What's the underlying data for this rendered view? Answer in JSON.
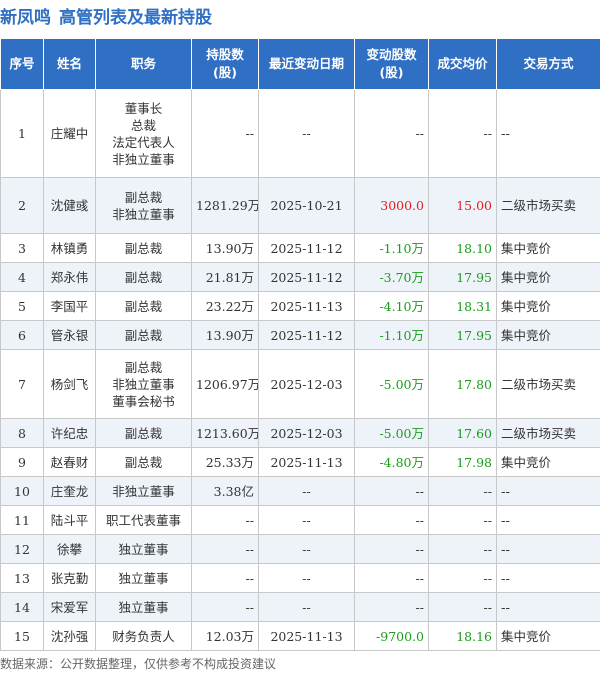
{
  "title": {
    "company": "新凤鸣",
    "subtitle": "高管列表及最新持股"
  },
  "columns": [
    "序号",
    "姓名",
    "职务",
    "持股数\n(股)",
    "最近变动日期",
    "变动股数\n(股)",
    "成交均价",
    "交易方式"
  ],
  "rows": [
    {
      "no": "1",
      "name": "庄耀中",
      "roles": [
        "董事长",
        "总裁",
        "法定代表人",
        "非独立董事"
      ],
      "shares": "--",
      "date": "--",
      "change": "--",
      "price": "--",
      "method": "--",
      "change_color": "none",
      "price_color": "none"
    },
    {
      "no": "2",
      "name": "沈健彧",
      "roles": [
        "副总裁",
        "非独立董事"
      ],
      "shares": "1281.29万",
      "date": "2025-10-21",
      "change": "3000.0",
      "price": "15.00",
      "method": "二级市场买卖",
      "change_color": "red",
      "price_color": "red"
    },
    {
      "no": "3",
      "name": "林镇勇",
      "roles": [
        "副总裁"
      ],
      "shares": "13.90万",
      "date": "2025-11-12",
      "change": "-1.10万",
      "price": "18.10",
      "method": "集中竞价",
      "change_color": "green",
      "price_color": "green"
    },
    {
      "no": "4",
      "name": "郑永伟",
      "roles": [
        "副总裁"
      ],
      "shares": "21.81万",
      "date": "2025-11-12",
      "change": "-3.70万",
      "price": "17.95",
      "method": "集中竞价",
      "change_color": "green",
      "price_color": "green"
    },
    {
      "no": "5",
      "name": "李国平",
      "roles": [
        "副总裁"
      ],
      "shares": "23.22万",
      "date": "2025-11-13",
      "change": "-4.10万",
      "price": "18.31",
      "method": "集中竞价",
      "change_color": "green",
      "price_color": "green"
    },
    {
      "no": "6",
      "name": "管永银",
      "roles": [
        "副总裁"
      ],
      "shares": "13.90万",
      "date": "2025-11-12",
      "change": "-1.10万",
      "price": "17.95",
      "method": "集中竞价",
      "change_color": "green",
      "price_color": "green"
    },
    {
      "no": "7",
      "name": "杨剑飞",
      "roles": [
        "副总裁",
        "非独立董事",
        "董事会秘书"
      ],
      "shares": "1206.97万",
      "date": "2025-12-03",
      "change": "-5.00万",
      "price": "17.80",
      "method": "二级市场买卖",
      "change_color": "green",
      "price_color": "green"
    },
    {
      "no": "8",
      "name": "许纪忠",
      "roles": [
        "副总裁"
      ],
      "shares": "1213.60万",
      "date": "2025-12-03",
      "change": "-5.00万",
      "price": "17.60",
      "method": "二级市场买卖",
      "change_color": "green",
      "price_color": "green"
    },
    {
      "no": "9",
      "name": "赵春财",
      "roles": [
        "副总裁"
      ],
      "shares": "25.33万",
      "date": "2025-11-13",
      "change": "-4.80万",
      "price": "17.98",
      "method": "集中竞价",
      "change_color": "green",
      "price_color": "green"
    },
    {
      "no": "10",
      "name": "庄奎龙",
      "roles": [
        "非独立董事"
      ],
      "shares": "3.38亿",
      "date": "--",
      "change": "--",
      "price": "--",
      "method": "--",
      "change_color": "none",
      "price_color": "none"
    },
    {
      "no": "11",
      "name": "陆斗平",
      "roles": [
        "职工代表董事"
      ],
      "shares": "--",
      "date": "--",
      "change": "--",
      "price": "--",
      "method": "--",
      "change_color": "none",
      "price_color": "none"
    },
    {
      "no": "12",
      "name": "徐攀",
      "roles": [
        "独立董事"
      ],
      "shares": "--",
      "date": "--",
      "change": "--",
      "price": "--",
      "method": "--",
      "change_color": "none",
      "price_color": "none"
    },
    {
      "no": "13",
      "name": "张克勤",
      "roles": [
        "独立董事"
      ],
      "shares": "--",
      "date": "--",
      "change": "--",
      "price": "--",
      "method": "--",
      "change_color": "none",
      "price_color": "none"
    },
    {
      "no": "14",
      "name": "宋爱军",
      "roles": [
        "独立董事"
      ],
      "shares": "--",
      "date": "--",
      "change": "--",
      "price": "--",
      "method": "--",
      "change_color": "none",
      "price_color": "none"
    },
    {
      "no": "15",
      "name": "沈孙强",
      "roles": [
        "财务负责人"
      ],
      "shares": "12.03万",
      "date": "2025-11-13",
      "change": "-9700.0",
      "price": "18.16",
      "method": "集中竞价",
      "change_color": "green",
      "price_color": "green"
    }
  ],
  "footer": "数据来源：公开数据整理，仅供参考不构成投资建议",
  "colors": {
    "accent": "#2f6fc4",
    "up": "#e02020",
    "down": "#1a9e1a"
  }
}
